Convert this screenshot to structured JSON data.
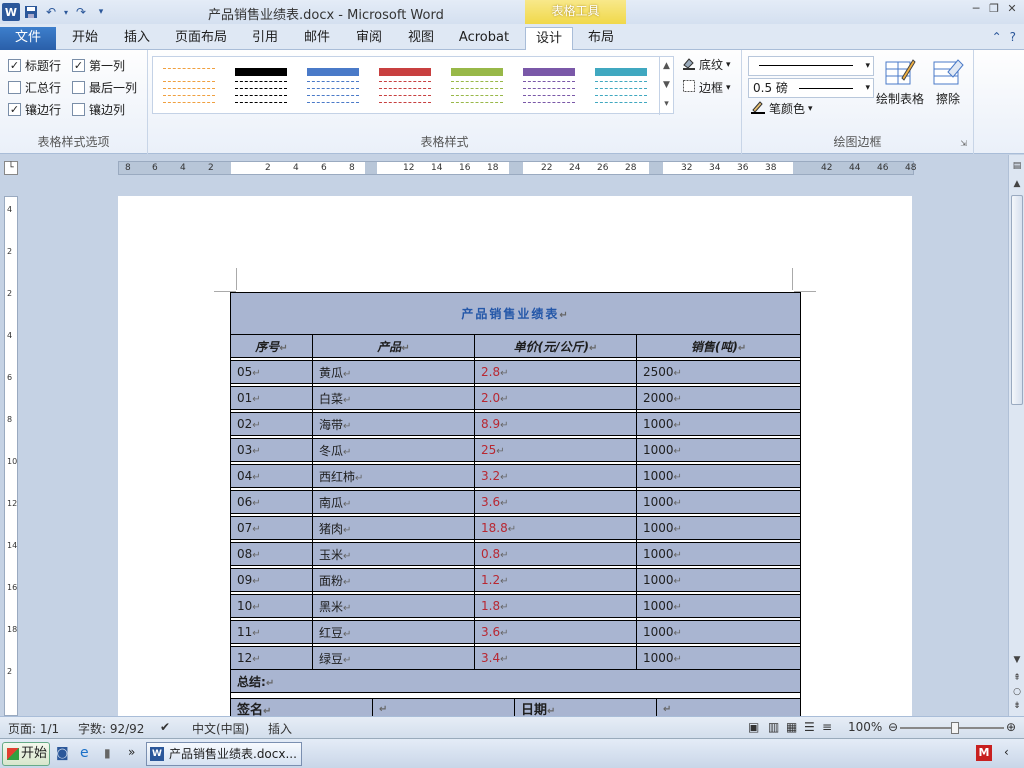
{
  "window": {
    "title": "产品销售业绩表.docx  -  Microsoft Word",
    "contextual_tab_group": "表格工具"
  },
  "tabs": [
    {
      "label": "文件"
    },
    {
      "label": "开始"
    },
    {
      "label": "插入"
    },
    {
      "label": "页面布局"
    },
    {
      "label": "引用"
    },
    {
      "label": "邮件"
    },
    {
      "label": "审阅"
    },
    {
      "label": "视图"
    },
    {
      "label": "Acrobat"
    },
    {
      "label": "设计"
    },
    {
      "label": "布局"
    }
  ],
  "active_tab": "设计",
  "ribbon": {
    "style_options": {
      "group_label": "表格样式选项",
      "items": [
        {
          "label": "标题行",
          "checked": true
        },
        {
          "label": "第一列",
          "checked": true
        },
        {
          "label": "汇总行",
          "checked": false
        },
        {
          "label": "最后一列",
          "checked": false
        },
        {
          "label": "镶边行",
          "checked": true
        },
        {
          "label": "镶边列",
          "checked": false
        }
      ]
    },
    "table_styles": {
      "group_label": "表格样式",
      "shading_label": "底纹",
      "borders_label": "边框",
      "thumb_colors": [
        "#f0a040",
        "#000000",
        "#4a7ac8",
        "#c84040",
        "#98b848",
        "#7a58a8",
        "#40a8c0"
      ]
    },
    "draw_borders": {
      "group_label": "绘图边框",
      "line_weight": "0.5 磅",
      "pen_color_label": "笔颜色",
      "draw_table_label": "绘制表格",
      "eraser_label": "擦除"
    }
  },
  "ruler": {
    "numbers": [
      "8",
      "6",
      "4",
      "2",
      "2",
      "4",
      "6",
      "8",
      "12",
      "14",
      "16",
      "18",
      "22",
      "24",
      "26",
      "28",
      "32",
      "34",
      "36",
      "38",
      "42",
      "44",
      "46",
      "48"
    ],
    "vertical_numbers": [
      "4",
      "2",
      "2",
      "4",
      "6",
      "8",
      "10",
      "12",
      "14",
      "16",
      "18",
      "2"
    ]
  },
  "document": {
    "table_title": "产品销售业绩表",
    "headers": [
      "序号",
      "产品",
      "单价(元/公斤)",
      "销售(吨)"
    ],
    "rows": [
      {
        "id": "05",
        "product": "黄瓜",
        "price": "2.8",
        "sales": "2500"
      },
      {
        "id": "01",
        "product": "白菜",
        "price": "2.0",
        "sales": "2000"
      },
      {
        "id": "02",
        "product": "海带",
        "price": "8.9",
        "sales": "1000"
      },
      {
        "id": "03",
        "product": "冬瓜",
        "price": "25",
        "sales": "1000"
      },
      {
        "id": "04",
        "product": "西红柿",
        "price": "3.2",
        "sales": "1000"
      },
      {
        "id": "06",
        "product": "南瓜",
        "price": "3.6",
        "sales": "1000"
      },
      {
        "id": "07",
        "product": "猪肉",
        "price": "18.8",
        "sales": "1000"
      },
      {
        "id": "08",
        "product": "玉米",
        "price": "0.8",
        "sales": "1000"
      },
      {
        "id": "09",
        "product": "面粉",
        "price": "1.2",
        "sales": "1000"
      },
      {
        "id": "10",
        "product": "黑米",
        "price": "1.8",
        "sales": "1000"
      },
      {
        "id": "11",
        "product": "红豆",
        "price": "3.6",
        "sales": "1000"
      },
      {
        "id": "12",
        "product": "绿豆",
        "price": "3.4",
        "sales": "1000"
      }
    ],
    "summary_label": "总结:",
    "sign_label": "签名",
    "date_label": "日期"
  },
  "statusbar": {
    "page": "页面: 1/1",
    "words": "字数: 92/92",
    "language": "中文(中国)",
    "mode": "插入",
    "zoom": "100%"
  },
  "taskbar": {
    "start_label": "开始",
    "task_label": "产品销售业绩表.docx..."
  }
}
